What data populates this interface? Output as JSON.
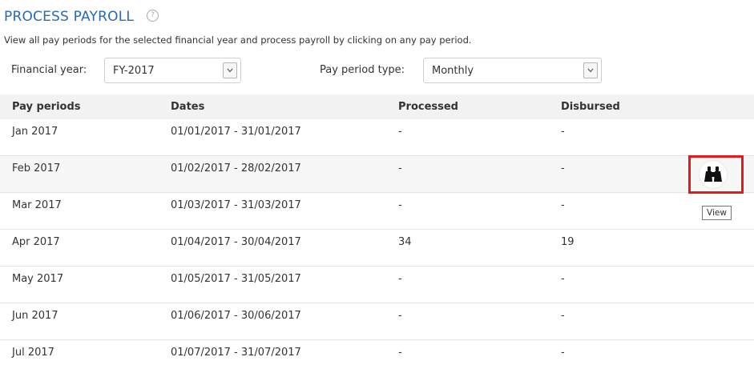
{
  "page": {
    "title": "PROCESS PAYROLL",
    "description": "View all pay periods for the selected financial year and process payroll by clicking on any pay period."
  },
  "filters": {
    "financial_year_label": "Financial year:",
    "financial_year_value": "FY-2017",
    "pay_period_type_label": "Pay period type:",
    "pay_period_type_value": "Monthly"
  },
  "table": {
    "columns": [
      "Pay periods",
      "Dates",
      "Processed",
      "Disbursed"
    ],
    "rows": [
      {
        "period": "Jan 2017",
        "dates": "01/01/2017 - 31/01/2017",
        "processed": "-",
        "disbursed": "-"
      },
      {
        "period": "Feb 2017",
        "dates": "01/02/2017 - 28/02/2017",
        "processed": "-",
        "disbursed": "-"
      },
      {
        "period": "Mar 2017",
        "dates": "01/03/2017 - 31/03/2017",
        "processed": "-",
        "disbursed": "-"
      },
      {
        "period": "Apr 2017",
        "dates": "01/04/2017 - 30/04/2017",
        "processed": "34",
        "disbursed": "19"
      },
      {
        "period": "May 2017",
        "dates": "01/05/2017 - 31/05/2017",
        "processed": "-",
        "disbursed": "-"
      },
      {
        "period": "Jun 2017",
        "dates": "01/06/2017 - 30/06/2017",
        "processed": "-",
        "disbursed": "-"
      },
      {
        "period": "Jul 2017",
        "dates": "01/07/2017 - 31/07/2017",
        "processed": "-",
        "disbursed": "-"
      }
    ]
  },
  "row_action": {
    "icon": "binoculars-icon",
    "tooltip": "View"
  },
  "colors": {
    "title_blue": "#2a6aad",
    "highlight_red": "#e3191b",
    "header_bg": "#f2f2f2",
    "alt_row_bg": "#f7f7f7"
  }
}
